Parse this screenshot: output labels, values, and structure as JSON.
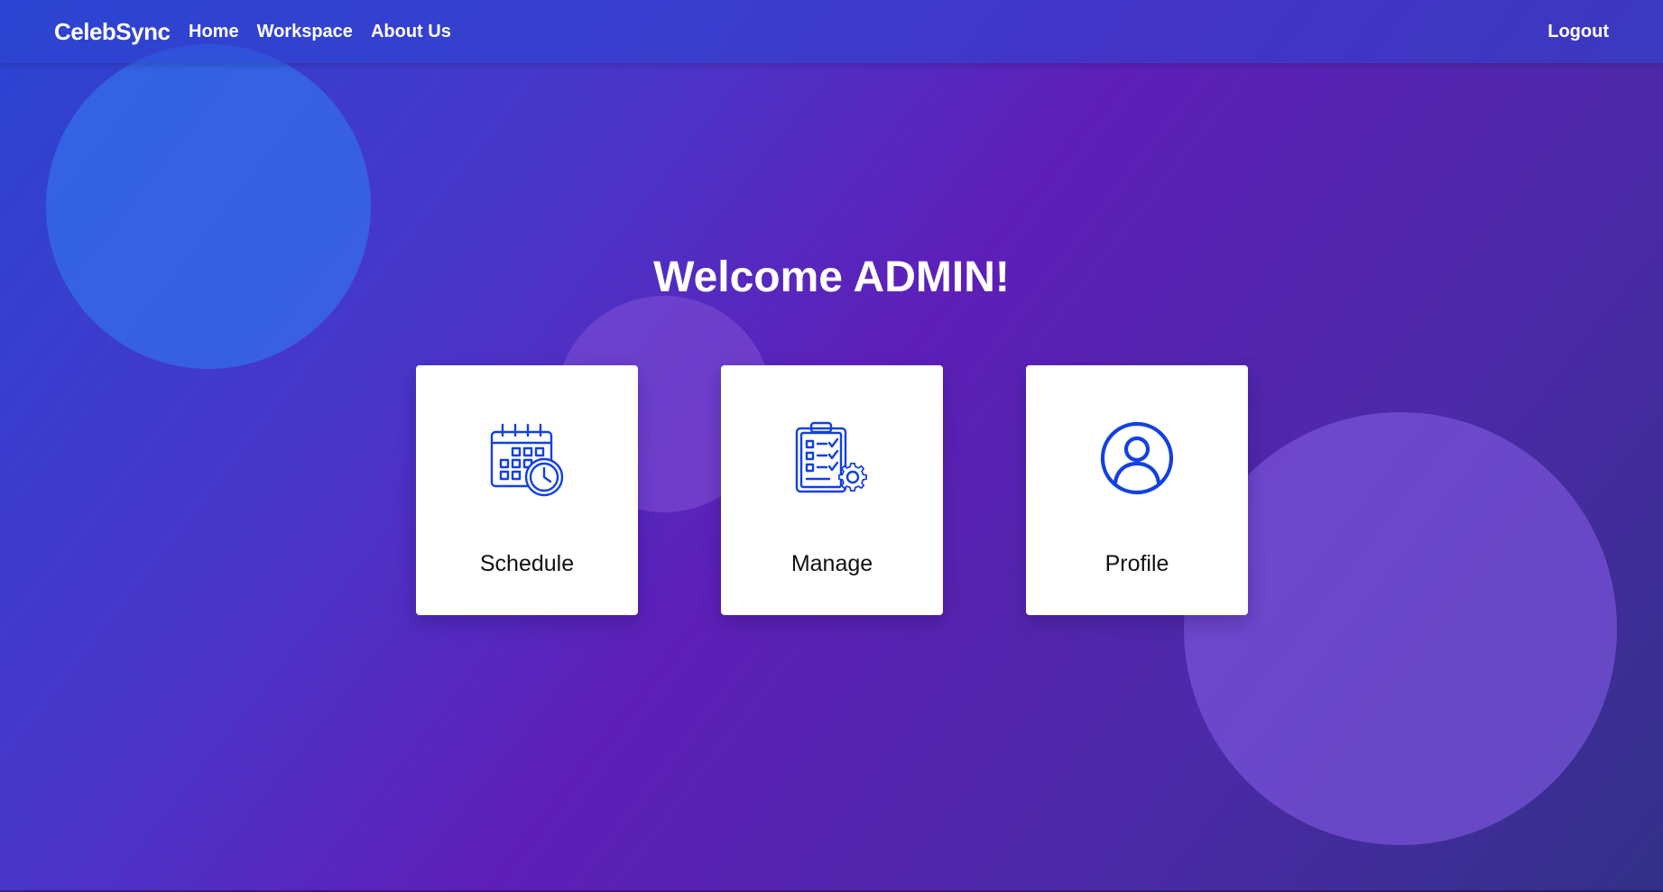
{
  "navbar": {
    "brand": "CelebSync",
    "links": [
      "Home",
      "Workspace",
      "About Us"
    ],
    "logout": "Logout"
  },
  "main": {
    "welcome": "Welcome ADMIN!",
    "cards": [
      {
        "label": "Schedule",
        "icon": "calendar-clock-icon"
      },
      {
        "label": "Manage",
        "icon": "clipboard-gear-icon"
      },
      {
        "label": "Profile",
        "icon": "user-circle-icon"
      }
    ]
  },
  "colors": {
    "icon": "#1340e0",
    "card_background": "#ffffff",
    "text_on_gradient": "#ffffff"
  }
}
